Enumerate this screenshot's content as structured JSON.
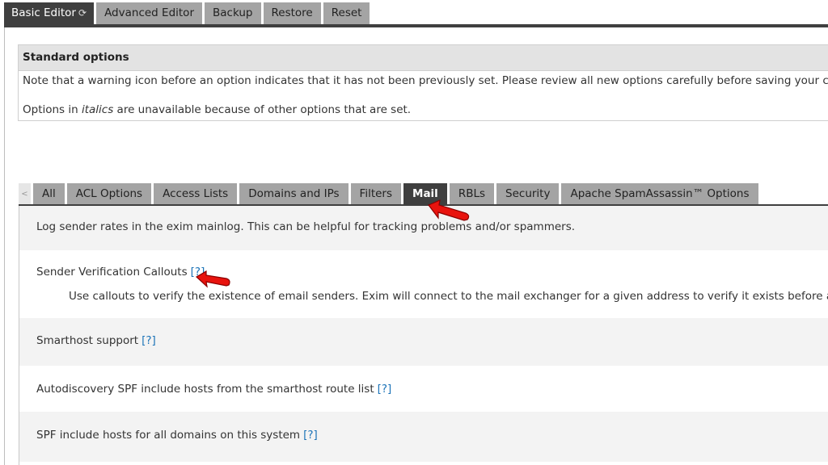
{
  "top_tabs": [
    {
      "label": "Basic Editor",
      "active": true
    },
    {
      "label": "Advanced Editor",
      "active": false
    },
    {
      "label": "Backup",
      "active": false
    },
    {
      "label": "Restore",
      "active": false
    },
    {
      "label": "Reset",
      "active": false
    }
  ],
  "standard_options": {
    "title": "Standard options",
    "warning_note": "Note that a warning icon before an option indicates that it has not been previously set. Please review all new options carefully before saving your changes.",
    "italics_note_before": "Options in ",
    "italics_word": "italics",
    "italics_note_after": " are unavailable because of other options that are set."
  },
  "category_tabs": {
    "scroll_left_glyph": "<",
    "items": [
      {
        "label": "All",
        "active": false
      },
      {
        "label": "ACL Options",
        "active": false
      },
      {
        "label": "Access Lists",
        "active": false
      },
      {
        "label": "Domains and IPs",
        "active": false
      },
      {
        "label": "Filters",
        "active": false
      },
      {
        "label": "Mail",
        "active": true
      },
      {
        "label": "RBLs",
        "active": false
      },
      {
        "label": "Security",
        "active": false
      },
      {
        "label": "Apache SpamAssassin™ Options",
        "active": false
      }
    ]
  },
  "options": [
    {
      "label": "Log sender rates in the exim mainlog. This can be helpful for tracking problems and/or spammers."
    },
    {
      "label": "Sender Verification Callouts",
      "help": "[?]",
      "description": "Use callouts to verify the existence of email senders. Exim will connect to the mail exchanger for a given address to verify it exists before accepting"
    },
    {
      "label": "Smarthost support",
      "help": "[?]"
    },
    {
      "label": "Autodiscovery SPF include hosts from the smarthost route list",
      "help": "[?]"
    },
    {
      "label": "SPF include hosts for all domains on this system",
      "help": "[?]"
    }
  ],
  "colors": {
    "active_tab": "#3f3f3f",
    "inactive_tab": "#a4a4a4",
    "help_link": "#1d74b8",
    "annotation_arrow": "#e8130e"
  },
  "icons": {
    "basic_editor_icon": "refresh-icon"
  }
}
